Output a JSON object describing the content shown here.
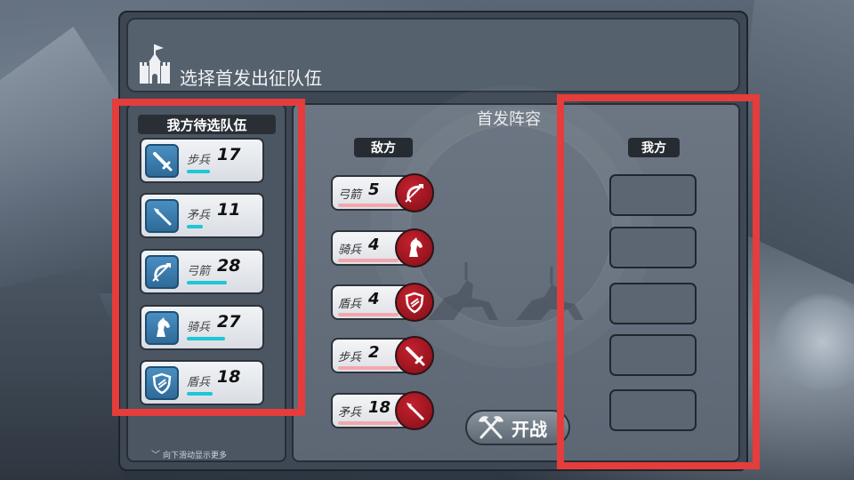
{
  "header": {
    "title": "选择首发出征队伍"
  },
  "left_panel": {
    "tab_label": "我方待选队伍",
    "scroll_hint": "向下滑动显示更多"
  },
  "my_units": [
    {
      "name": "步兵",
      "count": "17",
      "icon": "sword-icon",
      "bar_fill": 0.33
    },
    {
      "name": "矛兵",
      "count": "11",
      "icon": "spear-icon",
      "bar_fill": 0.22
    },
    {
      "name": "弓箭",
      "count": "28",
      "icon": "bow-icon",
      "bar_fill": 0.56
    },
    {
      "name": "骑兵",
      "count": "27",
      "icon": "horse-icon",
      "bar_fill": 0.54
    },
    {
      "name": "盾兵",
      "count": "18",
      "icon": "shield-icon",
      "bar_fill": 0.36
    }
  ],
  "lineup": {
    "title": "首发阵容",
    "enemy_label": "敌方",
    "ally_label": "我方",
    "ally_slots": 5
  },
  "enemy_units": [
    {
      "name": "弓箭",
      "count": "5",
      "icon": "bow-icon"
    },
    {
      "name": "骑兵",
      "count": "4",
      "icon": "horse-icon"
    },
    {
      "name": "盾兵",
      "count": "4",
      "icon": "shield-icon"
    },
    {
      "name": "步兵",
      "count": "2",
      "icon": "sword-icon"
    },
    {
      "name": "矛兵",
      "count": "18",
      "icon": "spear-icon"
    }
  ],
  "start_button": {
    "label": "开战",
    "icon": "crossed-axes-icon"
  },
  "colors": {
    "highlight": "#e53c3c",
    "my_bar": "#1ec6d6",
    "enemy_bar": "#f3a7ad",
    "enemy_badge": "#b01a26",
    "my_icon": "#3a7fb5"
  }
}
